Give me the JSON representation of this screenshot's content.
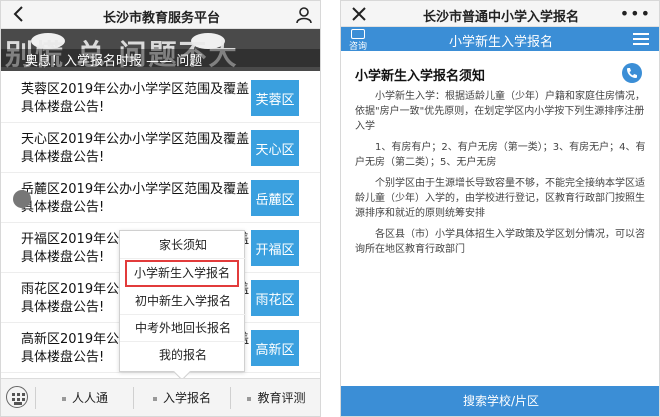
{
  "left": {
    "header_title": "长沙市教育服务平台",
    "banner": {
      "big_text": "别慌 总  问题不大",
      "caption": "奥息！入学报名时报 —— 问题"
    },
    "news": [
      {
        "title": "芙蓉区2019年公办小学学区范围及覆盖具体楼盘公告!",
        "tag": "芙蓉区"
      },
      {
        "title": "天心区2019年公办小学学区范围及覆盖具体楼盘公告!",
        "tag": "天心区"
      },
      {
        "title": "岳麓区2019年公办小学学区范围及覆盖具体楼盘公告!",
        "tag": "岳麓区"
      },
      {
        "title": "开福区2019年公办小学学区范围及覆盖具体楼盘公告!",
        "tag": "开福区"
      },
      {
        "title": "雨花区2019年公办小学学区范围及覆盖具体楼盘公告!",
        "tag": "雨花区"
      },
      {
        "title": "高新区2019年公办小学学区范围及覆盖具体楼盘公告!",
        "tag": "高新区"
      }
    ],
    "popup_menu": [
      "家长须知",
      "小学新生入学报名",
      "初中新生入学报名",
      "中考外地回长报名",
      "我的报名"
    ],
    "tabs": [
      "人人通",
      "入学报名",
      "教育评测"
    ]
  },
  "right": {
    "header_title": "长沙市普通中小学入学报名",
    "consult_label": "咨询",
    "page_title": "小学新生入学报名",
    "notice_title": "小学新生入学报名须知",
    "notice_paragraphs": [
      "小学新生入学：根据适龄儿童（少年）户籍和家庭住房情况，依据\"房户一致\"优先原则，在划定学区内小学按下列生源排序注册入学",
      "1、有房有户；2、有户无房（第一类）；3、有房无户；4、有户无房（第二类）；5、无户无房",
      "个别学区由于生源增长导致容量不够，不能完全接纳本学区适龄儿童（少年）入学的，由学校进行登记，区教育行政部门按照生源排序和就近的原则统筹安排",
      "各区县（市）小学具体招生入学政策及学区划分情况，可以咨询所在地区教育行政部门"
    ],
    "bottom_button": "搜索学校/片区"
  }
}
